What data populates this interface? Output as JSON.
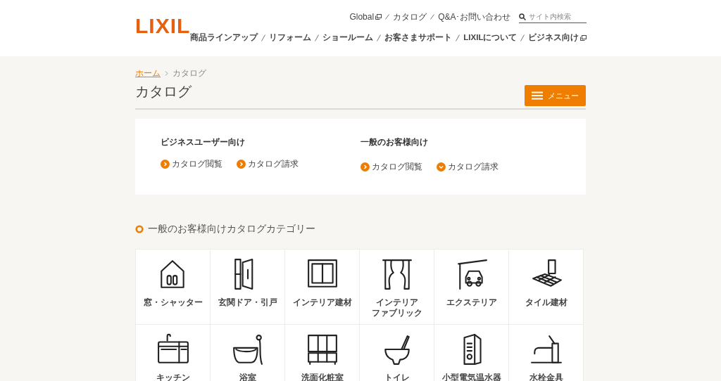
{
  "header": {
    "logo": "LIXIL",
    "utility_links": [
      {
        "label": "Global",
        "external": true
      },
      {
        "label": "カタログ",
        "external": false
      },
      {
        "label": "Q&A･お問い合わせ",
        "external": false
      }
    ],
    "search": {
      "placeholder": "サイト内検索"
    },
    "nav": [
      {
        "label": "商品ラインアップ",
        "external": false
      },
      {
        "label": "リフォーム",
        "external": false
      },
      {
        "label": "ショールーム",
        "external": false
      },
      {
        "label": "お客さまサポート",
        "external": false
      },
      {
        "label": "LIXILについて",
        "external": false
      },
      {
        "label": "ビジネス向け",
        "external": true
      }
    ]
  },
  "breadcrumb": [
    {
      "label": "ホーム",
      "link": true
    },
    {
      "label": "カタログ",
      "link": false
    }
  ],
  "page_title": "カタログ",
  "menu_button": "メニュー",
  "audiences": [
    {
      "title": "ビジネスユーザー向け",
      "links": [
        {
          "label": "カタログ閲覧",
          "kind": "link"
        },
        {
          "label": "カタログ請求",
          "kind": "link"
        }
      ]
    },
    {
      "title": "一般のお客様向け",
      "links": [
        {
          "label": "カタログ閲覧",
          "kind": "link"
        },
        {
          "label": "カタログ請求",
          "kind": "dropdown"
        }
      ]
    }
  ],
  "section_title": "一般のお客様向けカタログカテゴリー",
  "categories": [
    {
      "label": "窓・シャッター"
    },
    {
      "label": "玄関ドア・引戸"
    },
    {
      "label": "インテリア建材"
    },
    {
      "label": "インテリア",
      "label_line_2": "ファブリック"
    },
    {
      "label": "エクステリア"
    },
    {
      "label": "タイル建材"
    },
    {
      "label": "キッチン"
    },
    {
      "label": "浴室"
    },
    {
      "label": "洗面化粧室"
    },
    {
      "label": "トイレ"
    },
    {
      "label": "小型電気温水器"
    },
    {
      "label": "水栓金具"
    }
  ]
}
